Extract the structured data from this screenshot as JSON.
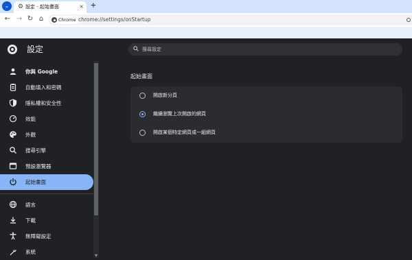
{
  "browser": {
    "tab_title": "設定 - 起始畫面",
    "tab_close": "×",
    "new_tab": "+",
    "tab_search": "⌄",
    "omnibox_chip": "Chrome",
    "url": "chrome://settings/onStartup",
    "nav_back": "←",
    "nav_forward": "→",
    "nav_reload": "↻",
    "nav_home": "⌂"
  },
  "settings": {
    "title": "設定",
    "search_placeholder": "搜尋設定"
  },
  "sidebar": {
    "items": [
      {
        "label": "你與 Google",
        "icon": "person-icon",
        "glyph": "👤"
      },
      {
        "label": "自動填入和密碼",
        "icon": "clipboard-icon",
        "glyph": "📋"
      },
      {
        "label": "隱私權和安全性",
        "icon": "shield-icon",
        "glyph": "🛡"
      },
      {
        "label": "效能",
        "icon": "speedometer-icon",
        "glyph": "◷"
      },
      {
        "label": "外觀",
        "icon": "palette-icon",
        "glyph": "🎨"
      },
      {
        "label": "搜尋引擎",
        "icon": "search-icon",
        "glyph": "🔍"
      },
      {
        "label": "預設瀏覽器",
        "icon": "browser-window-icon",
        "glyph": "▣"
      },
      {
        "label": "起始畫面",
        "icon": "power-icon",
        "glyph": "⏻",
        "active": true
      },
      {
        "label": "語言",
        "icon": "globe-icon",
        "glyph": "🌐"
      },
      {
        "label": "下載",
        "icon": "download-icon",
        "glyph": "⤓"
      },
      {
        "label": "無障礙設定",
        "icon": "accessibility-icon",
        "glyph": "♿"
      },
      {
        "label": "系統",
        "icon": "wrench-icon",
        "glyph": "🔧"
      }
    ]
  },
  "main": {
    "section_title": "起始畫面",
    "options": [
      {
        "label": "開啟新分頁",
        "checked": false
      },
      {
        "label": "繼續瀏覽上次開啟的網頁",
        "checked": true
      },
      {
        "label": "開啟某個特定網頁或一組網頁",
        "checked": false
      }
    ]
  },
  "colors": {
    "accent": "#8ab4f8",
    "background": "#202124",
    "card": "#2b2c2f",
    "tabstrip": "#d3e3fd"
  }
}
